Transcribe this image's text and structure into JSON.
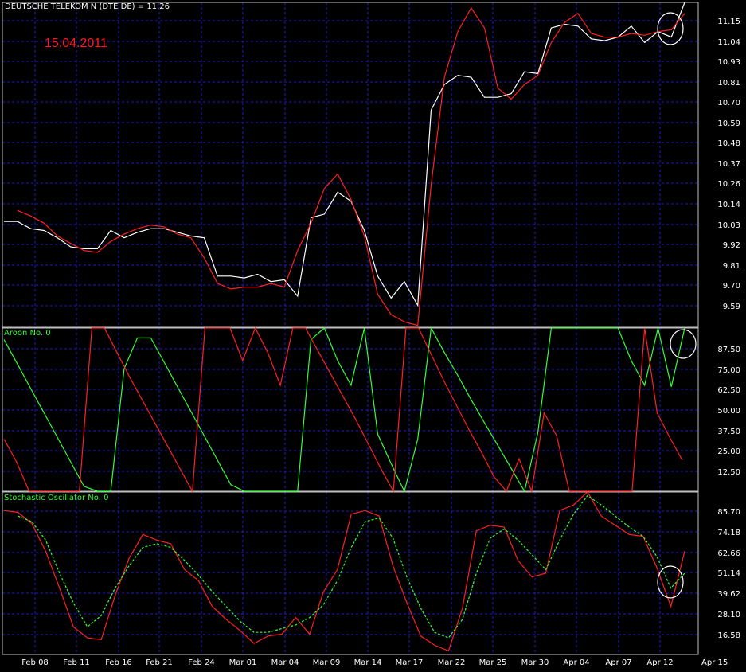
{
  "chart_data": [
    {
      "type": "line",
      "title": "DEUTSCHE TELEKOM N (DTE DE) = 11.26",
      "annotation": "15.04.2011",
      "ylim": [
        9.48,
        11.26
      ],
      "y_ticks": [
        "11.15",
        "11.04",
        "10.93",
        "10.81",
        "10.70",
        "10.59",
        "10.48",
        "10.37",
        "10.26",
        "10.14",
        "10.03",
        "9.92",
        "9.81",
        "9.70",
        "9.59"
      ],
      "grid": true,
      "series": [
        {
          "color": "#ffffff",
          "values": [
            10.06,
            10.06,
            10.02,
            10.01,
            9.97,
            9.92,
            9.91,
            9.91,
            10.01,
            9.97,
            10.0,
            10.02,
            10.02,
            10.0,
            9.98,
            9.97,
            9.76,
            9.76,
            9.75,
            9.77,
            9.73,
            9.74,
            9.65,
            10.08,
            10.1,
            10.22,
            10.17,
            10.01,
            9.76,
            9.64,
            9.73,
            9.6,
            10.67,
            10.81,
            10.86,
            10.85,
            10.74,
            10.74,
            10.76,
            10.88,
            10.87,
            11.12,
            11.14,
            11.13,
            11.06,
            11.05,
            11.07,
            11.13,
            11.04,
            11.1,
            11.07,
            11.26
          ]
        },
        {
          "color": "#ff2020",
          "values": [
            null,
            10.12,
            10.09,
            10.05,
            9.98,
            9.94,
            9.9,
            9.89,
            9.95,
            9.99,
            10.02,
            10.04,
            10.03,
            9.99,
            9.97,
            9.86,
            9.72,
            9.69,
            9.7,
            9.7,
            9.72,
            9.7,
            9.9,
            10.05,
            10.24,
            10.32,
            10.18,
            9.98,
            9.66,
            9.55,
            9.51,
            9.49,
            10.26,
            10.85,
            11.1,
            11.23,
            11.12,
            10.79,
            10.73,
            10.81,
            10.86,
            11.04,
            11.15,
            11.2,
            11.09,
            11.07,
            11.07,
            11.09,
            11.08,
            11.1,
            11.11,
            11.2
          ]
        }
      ]
    },
    {
      "type": "line",
      "title": "Aroon No. 0",
      "ylim": [
        0,
        100
      ],
      "y_ticks": [
        "87.50",
        "75.00",
        "62.50",
        "50.00",
        "37.50",
        "25.00",
        "12.50"
      ],
      "grid": true,
      "series": [
        {
          "color": "#33ff33",
          "values": [
            93,
            78,
            63,
            48,
            33,
            18,
            3,
            0,
            0,
            75,
            94,
            94,
            79,
            64,
            49,
            34,
            19,
            4,
            0,
            0,
            0,
            0,
            0,
            93,
            100,
            80,
            65,
            100,
            35,
            17,
            0,
            32,
            100,
            85,
            71,
            56,
            42,
            28,
            14,
            0,
            36,
            100,
            100,
            100,
            100,
            100,
            100,
            80,
            65,
            100,
            64,
            100
          ]
        },
        {
          "color": "#ff2020",
          "values": [
            32,
            18,
            0,
            0,
            0,
            0,
            0,
            100,
            100,
            85,
            70,
            56,
            42,
            28,
            14,
            0,
            100,
            100,
            100,
            80,
            100,
            85,
            65,
            100,
            100,
            86,
            72,
            58,
            44,
            29,
            14,
            0,
            100,
            100,
            84,
            68,
            53,
            38,
            24,
            9,
            0,
            20,
            0,
            48,
            34,
            0,
            0,
            0,
            0,
            0,
            0,
            100,
            48,
            33,
            19
          ]
        }
      ]
    },
    {
      "type": "line",
      "title": "Stochastic Oscillator No. 0",
      "ylim": [
        8,
        96
      ],
      "y_ticks": [
        "85.70",
        "74.18",
        "62.66",
        "51.14",
        "39.62",
        "28.10",
        "16.58"
      ],
      "grid": true,
      "series": [
        {
          "color": "#ff2020",
          "values": [
            86,
            85,
            79,
            64,
            44,
            23,
            17,
            16,
            40,
            60,
            73,
            70,
            68,
            54,
            48,
            34,
            27,
            21,
            14,
            18,
            19,
            28,
            19,
            42,
            54,
            84,
            86,
            83,
            56,
            36,
            18,
            13,
            10,
            33,
            75,
            78,
            77,
            59,
            50,
            52,
            86,
            89,
            96,
            83,
            78,
            73,
            72,
            55,
            34,
            64
          ]
        },
        {
          "color": "#33ff33",
          "dashed": true,
          "values": [
            null,
            83,
            80,
            70,
            52,
            36,
            23,
            29,
            44,
            56,
            66,
            68,
            66,
            59,
            51,
            42,
            34,
            26,
            20,
            20,
            22,
            24,
            28,
            35,
            48,
            66,
            80,
            82,
            71,
            50,
            33,
            20,
            17,
            27,
            52,
            71,
            76,
            70,
            62,
            54,
            70,
            84,
            94,
            89,
            83,
            77,
            72,
            61,
            44,
            52
          ]
        }
      ]
    },
    {
      "type": "axis",
      "x_ticks": [
        "Feb 08",
        "Feb 11",
        "Feb 16",
        "Feb 21",
        "Feb 24",
        "Mar 01",
        "Mar 04",
        "Mar 09",
        "Mar 14",
        "Mar 17",
        "Mar 22",
        "Mar 25",
        "Mar 30",
        "Apr 04",
        "Apr 07",
        "Apr 12",
        "Apr 15"
      ]
    }
  ]
}
